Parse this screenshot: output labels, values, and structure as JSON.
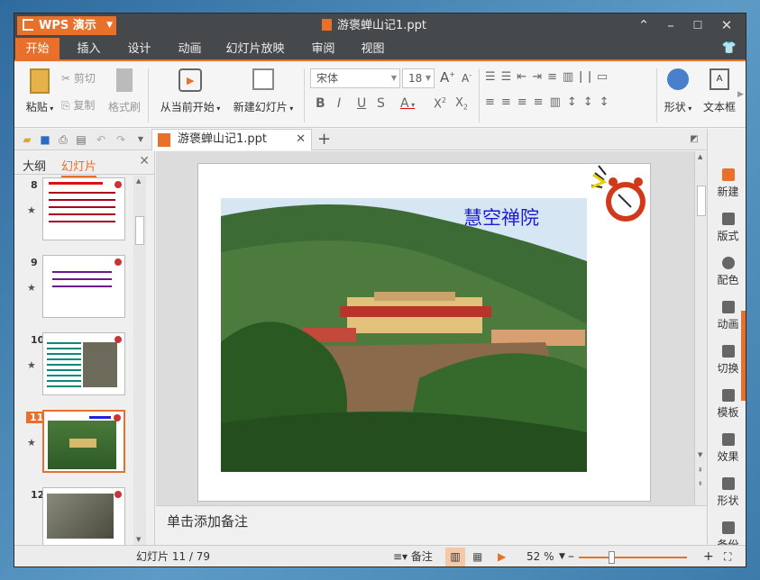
{
  "app": {
    "name": "WPS 演示",
    "doc_title": "游褒蝉山记1.ppt"
  },
  "tabs": [
    "开始",
    "插入",
    "设计",
    "动画",
    "幻灯片放映",
    "审阅",
    "视图"
  ],
  "ribbon": {
    "paste": "粘贴",
    "cut": "剪切",
    "copy": "复制",
    "format_painter": "格式刷",
    "play_current": "从当前开始",
    "new_slide": "新建幻灯片",
    "font_name": "宋体",
    "font_size": "18",
    "shapes": "形状",
    "textbox": "文本框"
  },
  "pane": {
    "outline_tab": "大纲",
    "slides_tab": "幻灯片",
    "thumbs": [
      "8",
      "9",
      "10",
      "11",
      "12"
    ],
    "selected": "11"
  },
  "slide": {
    "title": "慧空禅院",
    "notes_placeholder": "单击添加备注"
  },
  "taskpane": [
    "新建",
    "版式",
    "配色",
    "动画",
    "切换",
    "模板",
    "效果",
    "形状",
    "备份"
  ],
  "status": {
    "slide_counter": "幻灯片 11 / 79",
    "notes_label": "备注",
    "zoom": "52 %",
    "zoom_percent": 52
  },
  "colors": {
    "accent": "#e8702a",
    "titlebar": "#46494c",
    "slide_title": "#1a1ad6"
  }
}
